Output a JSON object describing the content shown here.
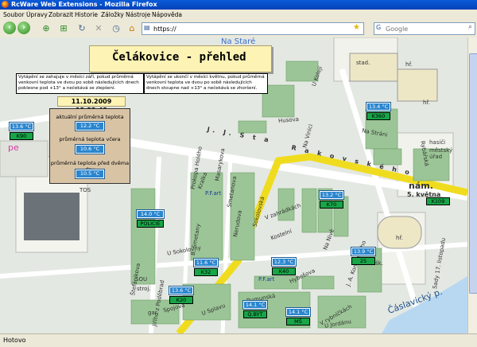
{
  "window": {
    "title": "RcWare Web Extensions - Mozilla Firefox"
  },
  "menu": [
    "Soubor",
    "Úpravy",
    "Zobrazit",
    "Historie",
    "Záložky",
    "Nástroje",
    "Nápověda"
  ],
  "toolbar": {
    "url": "https://",
    "search_placeholder": "Google"
  },
  "status": {
    "text": "Hotovo"
  },
  "panel": {
    "title": "Čelákovice - přehled",
    "info_left": "Vytápění se zahajuje v měsíci září, pokud průměrná venkovní teplota ve dvou po sobě následujících dnech poklesne pod +13° a nečekává se zlepšení.",
    "info_right": "Vytápění se ukončí v měsíci květnu, pokud průměrná venkovní teplota ve dvou po sobě následujících dnech stoupne nad +13° a nečekává se zhoršení.",
    "datetime": "11.10.2009 13:22:43",
    "avg_label": "aktuální průměrná teplota",
    "avg_value": "12.2 °C",
    "yesterday_label": "průměrná teplota včera",
    "yesterday_value": "10.6 °C",
    "twodays_label": "průměrná teplota před dvěma dny",
    "twodays_value": "10.5 °C"
  },
  "sensors": [
    {
      "temp": "13.6 °C",
      "name": "K90"
    },
    {
      "temp": "14.0 °C",
      "name": "POLICIE"
    },
    {
      "temp": "13.4 °C",
      "name": "K360"
    },
    {
      "temp": "13.2 °C",
      "name": "K70"
    },
    {
      "temp": "11.6 °C",
      "name": "K32"
    },
    {
      "temp": "12.3 °C",
      "name": "K40"
    },
    {
      "temp": "13.6 °C",
      "name": "K20"
    },
    {
      "temp": "14.1 °C",
      "name": "Q.BYT"
    },
    {
      "temp": "14.1 °C",
      "name": "MŠ"
    },
    {
      "temp": "13.9 °C",
      "name": "25"
    },
    {
      "temp": "",
      "name": "K109"
    }
  ],
  "map_labels": {
    "stad": "stad.",
    "hr1": "hř.",
    "hr2": "hř.",
    "hr3": "hř.",
    "sk": "šk.",
    "tos": "TOS",
    "sou": "SOU",
    "stroj": "stroj.",
    "gar": "gar.",
    "firestation": "hasiči",
    "town_hall": "městský úřad",
    "square": "nám.",
    "square2": "5. května",
    "pfart1": "P.F.art",
    "pfart2": "P.F.art",
    "pe": "pe",
    "na_stare": "Na Staré",
    "caslavicky": "Čáslavický p.",
    "prazska": "Rybářská",
    "sokolovska": "Sokolovská",
    "rakovska": "R a k o v s k é h o",
    "sta": "J. J. S t a",
    "kralka": "Kralka",
    "masarykova": "Masarykova",
    "v_zahrade": "V zahrádkách",
    "na_stranici": "Na Stráni",
    "rumunska": "Rumunská",
    "vychozi": "V rybníčkách",
    "pod_skalkou": "U Splavu",
    "husova": "Husova",
    "prokopa_holeho": "Prokopa Holého",
    "spojova": "Spojová",
    "na_stranu": "U Sokolovny",
    "kostelni": "J. A. Komenského",
    "stefanikova": "Štefánikova",
    "tgm": "Sady 17. listopadu",
    "ulicka": "U Kolejí",
    "nabrezi": "Na Vinici",
    "na_nive": "Na Nivě",
    "jiriho": "Jiřího z Poděbrad",
    "husovo": "Hybešova",
    "smetanova": "Smetanova",
    "stulikova": "B. Smetany",
    "na_stranu2": "Nerudova",
    "kostel": "Kostelní",
    "oblouk": "U Jordánu"
  }
}
